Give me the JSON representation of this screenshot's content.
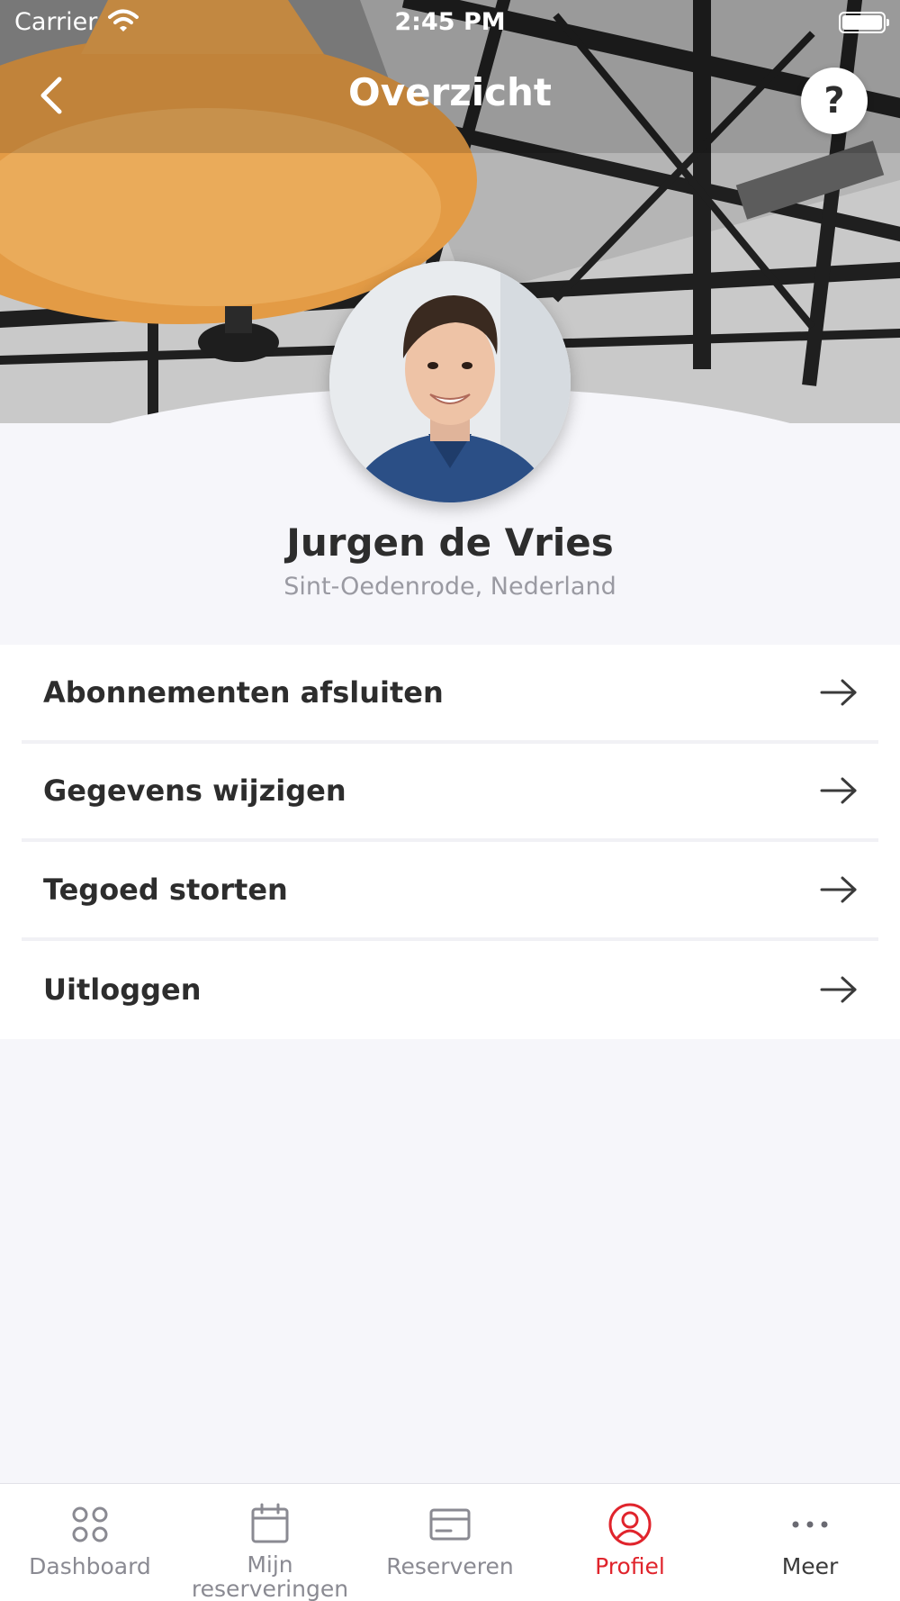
{
  "status_bar": {
    "carrier": "Carrier",
    "time": "2:45 PM"
  },
  "header": {
    "title": "Overzicht",
    "help_label": "?"
  },
  "profile": {
    "name": "Jurgen de Vries",
    "location": "Sint-Oedenrode, Nederland"
  },
  "menu": {
    "items": [
      {
        "label": "Abonnementen afsluiten",
        "icon": "arrow-right-icon"
      },
      {
        "label": "Gegevens wijzigen",
        "icon": "arrow-right-icon"
      },
      {
        "label": "Tegoed storten",
        "icon": "arrow-right-icon"
      },
      {
        "label": "Uitloggen",
        "icon": "arrow-right-icon"
      }
    ]
  },
  "tab_bar": {
    "tabs": [
      {
        "label": "Dashboard",
        "icon": "dashboard-icon"
      },
      {
        "label": "Mijn reserveringen",
        "icon": "calendar-icon"
      },
      {
        "label": "Reserveren",
        "icon": "card-icon"
      },
      {
        "label": "Profiel",
        "icon": "profile-icon",
        "active": true
      },
      {
        "label": "Meer",
        "icon": "more-icon"
      }
    ]
  },
  "colors": {
    "accent": "#e0242c",
    "background": "#f6f6fa",
    "text": "#2d2d2d",
    "muted": "#9a9aa2"
  }
}
